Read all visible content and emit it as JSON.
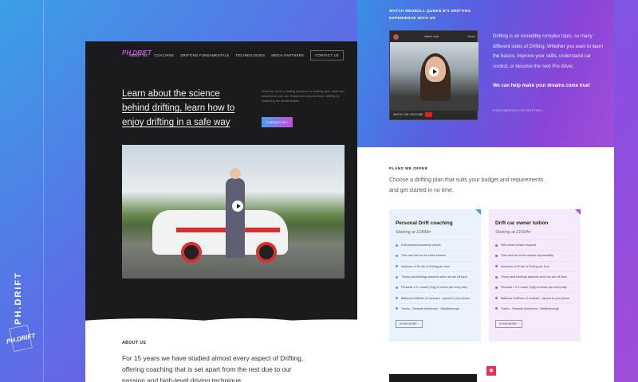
{
  "side": {
    "brand_vertical": "PH.DRIFT",
    "logo_text": "PH.DRIFT"
  },
  "nav": {
    "brand": "PH.DRIFT",
    "links": [
      "ABOUT US",
      "COACHING",
      "DRIFTING FUNDAMENTALS",
      "TECHNOLOGIES",
      "MEDIA PARTNERS"
    ],
    "contact": "CONTACT US"
  },
  "hero": {
    "title": "Learn about the science behind drifting, learn how to enjoy drifting in a safe way",
    "text": "Enter the world of drifting and learn to skillfully skim, slide and manoeuvre your car. Grasp your how-and-learn drifting by mastering the fundamentals.",
    "cta": "CONTACT US ›"
  },
  "about": {
    "label": "ABOUT US",
    "text": "For 15 years we have studied almost every aspect of Drifting, offering coaching that is set apart from the rest due to our passion and high-level driving technique."
  },
  "video": {
    "heading": "WATCH REDBULL QUEEN B'S DRIFTING EXPERIENCE WITH US",
    "watch_later": "Watch Later",
    "share": "Share",
    "youtube": "WATCH ON YOUTUBE"
  },
  "drift": {
    "text": "Drifting is an incredibly complex topic, so many different sides of Drifting. Whether you want to learn the basics, improve your skills, understand car control, or become the next Pro driver.",
    "cta": "We can help make your dreams come true!",
    "fund_label": "FUNDAMENTALS OF DRIFTING ›"
  },
  "plans": {
    "label": "PLANS WE OFFER",
    "text": "Choose a drifting plan that suits your budget and requirements and get started in no time.",
    "cards": [
      {
        "title": "Personal Drift coaching",
        "price": "Starting at £189/hr",
        "items": [
          "Drift prepared academy vehicle",
          "Tires and fuel for the entire session",
          "minimum of 20 min of Driving per hour",
          "Theory and briefings sessions when we are off track",
          "Personal 1-2-1 coach (Yogi) to follow you every step",
          "Battlecar DriftCam v2 included - synced to your phone",
          "Tracks - Teesside Autodrome - Middlesbrough"
        ],
        "more": "SHOW MORE ›"
      },
      {
        "title": "Drift car owner tuition",
        "price": "Starting at £169/hr",
        "items": [
          "Self owned vehicle required",
          "Tires and fuel at the owners responsibility",
          "minimum of 20 min of Driving per hour",
          "Theory and briefings sessions when we are off track",
          "Personal 1-2-1 coach (Yogi) to follow you every step",
          "Battlecar DriftCam v2 included - synced to your phone",
          "Tracks - Teesside Autodrome - Middlesbrough"
        ],
        "more": "SHOW MORE ›"
      }
    ]
  }
}
